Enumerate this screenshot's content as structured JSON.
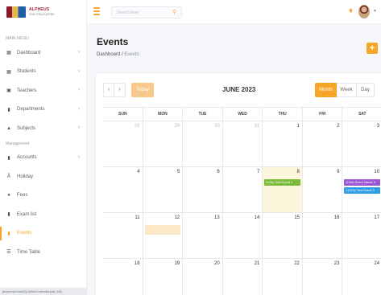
{
  "brand": {
    "name": "ALPHEUS",
    "subtitle": "THE EDUCATOR"
  },
  "sidebar": {
    "main_menu_label": "MAIN MENU",
    "management_label": "Management",
    "items": [
      {
        "label": "Dashboard",
        "icon": "dashboard-icon",
        "has_submenu": true
      },
      {
        "label": "Students",
        "icon": "students-icon",
        "has_submenu": true
      },
      {
        "label": "Teachers",
        "icon": "teachers-icon",
        "has_submenu": true
      },
      {
        "label": "Departments",
        "icon": "departments-icon",
        "has_submenu": true
      },
      {
        "label": "Subjects",
        "icon": "subjects-icon",
        "has_submenu": true
      }
    ],
    "management_items": [
      {
        "label": "Accounts",
        "icon": "accounts-icon",
        "has_submenu": true
      },
      {
        "label": "Holiday",
        "icon": "holiday-icon",
        "has_submenu": false
      },
      {
        "label": "Fees",
        "icon": "fees-icon",
        "has_submenu": false
      },
      {
        "label": "Exam list",
        "icon": "exam-icon",
        "has_submenu": false
      },
      {
        "label": "Events",
        "icon": "events-icon",
        "has_submenu": false,
        "active": true
      },
      {
        "label": "Time Table",
        "icon": "timetable-icon",
        "has_submenu": false
      }
    ],
    "status_url": "javascript:void(0);ArticleCalendar(cal_init)"
  },
  "topbar": {
    "search_placeholder": "Search here"
  },
  "page": {
    "title": "Events",
    "breadcrumb": [
      "Dashboard",
      "Events"
    ],
    "breadcrumb_sep": "/",
    "add_label": "+"
  },
  "calendar": {
    "title": "JUNE 2023",
    "today_label": "Today",
    "views": [
      "Month",
      "Week",
      "Day"
    ],
    "active_view": "Month",
    "weekdays": [
      "SUN",
      "MON",
      "TUE",
      "WED",
      "THU",
      "FRI",
      "SAT"
    ],
    "weeks": [
      [
        {
          "d": "28",
          "other": true
        },
        {
          "d": "29",
          "other": true
        },
        {
          "d": "30",
          "other": true
        },
        {
          "d": "31",
          "other": true
        },
        {
          "d": "1"
        },
        {
          "d": "2"
        },
        {
          "d": "3"
        }
      ],
      [
        {
          "d": "4"
        },
        {
          "d": "5"
        },
        {
          "d": "6"
        },
        {
          "d": "7"
        },
        {
          "d": "8",
          "today": true
        },
        {
          "d": "9"
        },
        {
          "d": "10"
        }
      ],
      [
        {
          "d": "11"
        },
        {
          "d": "12"
        },
        {
          "d": "13"
        },
        {
          "d": "14"
        },
        {
          "d": "15"
        },
        {
          "d": "16"
        },
        {
          "d": "17"
        }
      ],
      [
        {
          "d": "18"
        },
        {
          "d": "19"
        },
        {
          "d": "20"
        },
        {
          "d": "21"
        },
        {
          "d": "22"
        },
        {
          "d": "23"
        },
        {
          "d": "24"
        }
      ]
    ],
    "events": [
      {
        "date": "8",
        "time": "5:20p",
        "title": "Test Event 1",
        "color": "#7cbb3a"
      },
      {
        "date": "10",
        "time": "6:34a",
        "title": "Event Name 4",
        "color": "#9b56d6"
      },
      {
        "date": "10",
        "time": "12:07p",
        "title": "Test Event 3",
        "color": "#2e9fe6"
      }
    ]
  },
  "colors": {
    "accent": "#f6a52a",
    "today_bg": "#fdf5dc"
  }
}
